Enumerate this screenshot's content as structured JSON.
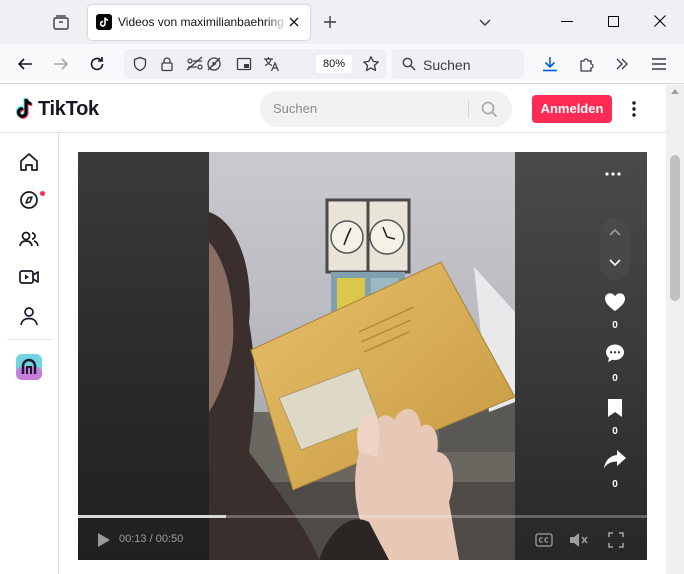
{
  "browser": {
    "tab_title": "Videos von maximilianbaehring",
    "zoom": "80%",
    "search_placeholder": "Suchen"
  },
  "site": {
    "logo": "TikTok",
    "search_placeholder": "Suchen",
    "login_label": "Anmelden",
    "sidebar": [
      "home-icon",
      "explore-icon",
      "following-icon",
      "live-icon",
      "profile-icon",
      "avatar"
    ]
  },
  "player": {
    "time": "00:13 / 00:50",
    "progress": 0.26,
    "likes": "0",
    "comments": "0",
    "saves": "0",
    "shares": "0"
  },
  "colors": {
    "brand": "#fe2c55",
    "notification_dot": "#fe2c55"
  }
}
